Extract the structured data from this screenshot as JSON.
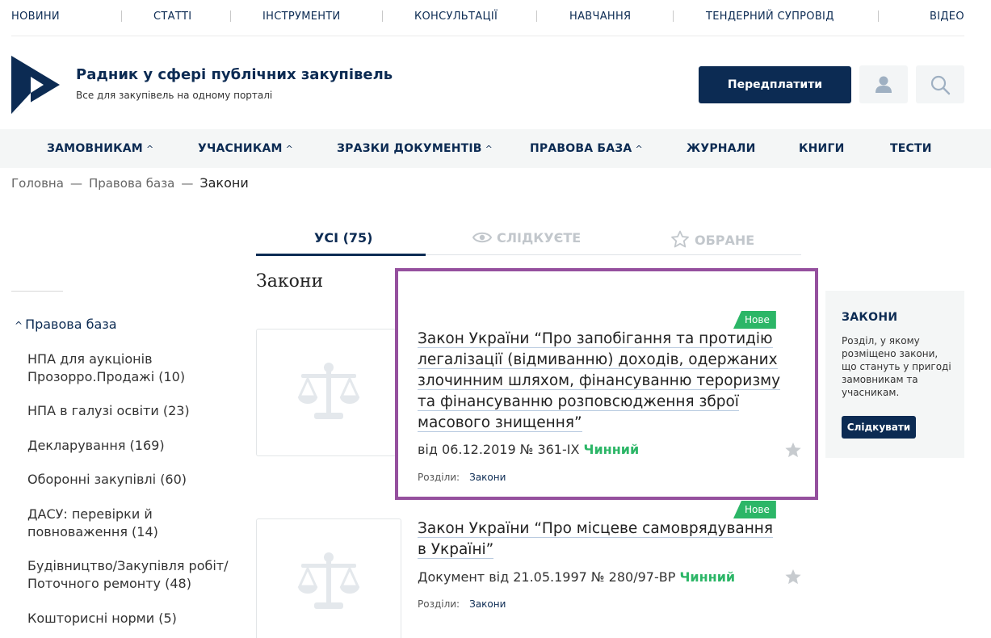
{
  "topnav": {
    "items": [
      "НОВИНИ",
      "СТАТТІ",
      "ІНСТРУМЕНТИ",
      "КОНСУЛЬТАЦІЇ",
      "НАВЧАННЯ",
      "ТЕНДЕРНИЙ СУПРОВІД",
      "ВІДЕО"
    ]
  },
  "header": {
    "title": "Радник у сфері публічних закупівель",
    "subtitle": "Все для закупівель на одному порталі",
    "subscribe_label": "Передплатити",
    "user_icon": "user-icon",
    "search_icon": "search-icon"
  },
  "mainnav": {
    "items": [
      "ЗАМОВНИКАМ",
      "УЧАСНИКАМ",
      "ЗРАЗКИ ДОКУМЕНТІВ",
      "ПРАВОВА БАЗА",
      "ЖУРНАЛИ",
      "КНИГИ",
      "ТЕСТИ"
    ],
    "chevron": "^"
  },
  "breadcrumb": {
    "items": [
      "Головна",
      "Правова база",
      "Закони"
    ],
    "separator": "—"
  },
  "tabs": {
    "all": "УСІ (75)",
    "following": "СЛІДКУЄТЕ",
    "favorites": "ОБРАНЕ"
  },
  "section_title": "Закони",
  "sidebar": {
    "root": "Правова база",
    "items": [
      "НПА для аукціонів Прозорро.Продажі (10)",
      "НПА в галузі освіти (23)",
      "Декларування (169)",
      "Оборонні закупівлі (60)",
      "ДАСУ: перевірки й повноваження (14)",
      "Будівництво/Закупівля робіт/ Поточного ремонту (48)",
      "Кошторисні норми (5)"
    ]
  },
  "documents": [
    {
      "badge": "Нове",
      "title": "Закон України “Про запобігання та протидію легалізації (відмиванню) доходів, одержаних злочинним шляхом, фінансуванню тероризму та фінансуванню розповсюдження зброї масового знищення”",
      "meta": "від 06.12.2019 № 361-IX",
      "status": "Чинний",
      "sections_label": "Розділи:",
      "section": "Закони"
    },
    {
      "badge": "Нове",
      "title": "Закон України “Про місцеве самоврядування в Україні”",
      "meta": "Документ від 21.05.1997 № 280/97-ВР",
      "status": "Чинний",
      "sections_label": "Розділи:",
      "section": "Закони"
    }
  ],
  "info_box": {
    "title": "ЗАКОНИ",
    "text": "Розділ, у якому розміщено закони, що стануть у пригоді замовникам та учасникам.",
    "button": "Слідкувати"
  },
  "colors": {
    "brand": "#0c2b53",
    "status_green": "#2cb667",
    "highlight": "#95509e"
  }
}
